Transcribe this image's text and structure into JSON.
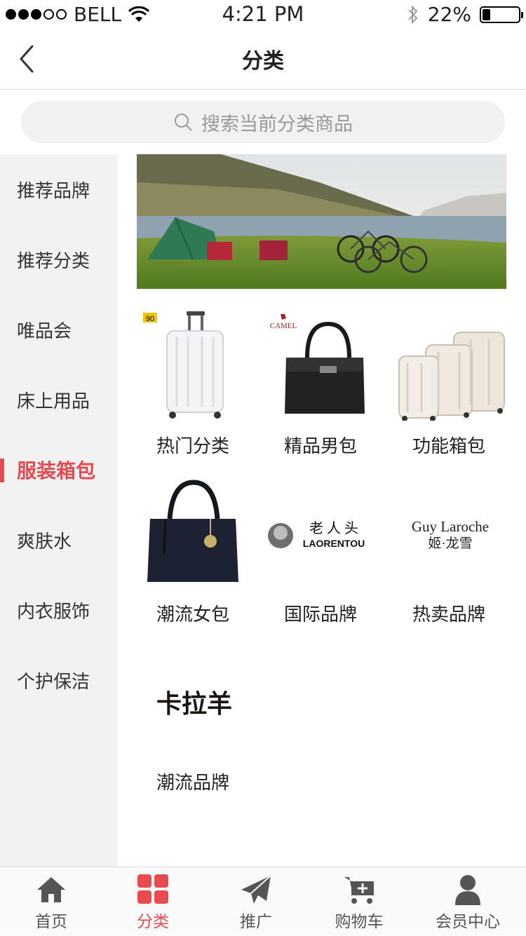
{
  "status_bar": {
    "carrier": "BELL",
    "time": "4:21 PM",
    "battery": "22%",
    "battery_level": 0.22
  },
  "header": {
    "title": "分类"
  },
  "search": {
    "placeholder": "搜索当前分类商品"
  },
  "sidebar": {
    "items": [
      {
        "label": "推荐品牌"
      },
      {
        "label": "推荐分类"
      },
      {
        "label": "唯品会"
      },
      {
        "label": "床上用品"
      },
      {
        "label": "服装箱包",
        "active": true
      },
      {
        "label": "爽肤水"
      },
      {
        "label": "内衣服饰"
      },
      {
        "label": "个护保洁"
      }
    ]
  },
  "grid": {
    "items": [
      {
        "label": "热门分类",
        "badge": "90"
      },
      {
        "label": "精品男包",
        "brand": "CAMEL"
      },
      {
        "label": "功能箱包"
      },
      {
        "label": "潮流女包"
      },
      {
        "label": "国际品牌",
        "brand_cn": "老 人 头",
        "brand_en": "LAORENTOU"
      },
      {
        "label": "热卖品牌",
        "brand_en": "Guy Laroche",
        "brand_cn": "姬·龙雪"
      },
      {
        "label": "潮流品牌",
        "brand_cn": "卡拉羊"
      }
    ]
  },
  "tabbar": {
    "items": [
      {
        "label": "首页",
        "icon": "home-icon"
      },
      {
        "label": "分类",
        "icon": "grid-icon",
        "active": true
      },
      {
        "label": "推广",
        "icon": "paper-plane-icon"
      },
      {
        "label": "购物车",
        "icon": "cart-icon"
      },
      {
        "label": "会员中心",
        "icon": "user-icon"
      }
    ]
  },
  "colors": {
    "accent": "#e94a4f"
  }
}
